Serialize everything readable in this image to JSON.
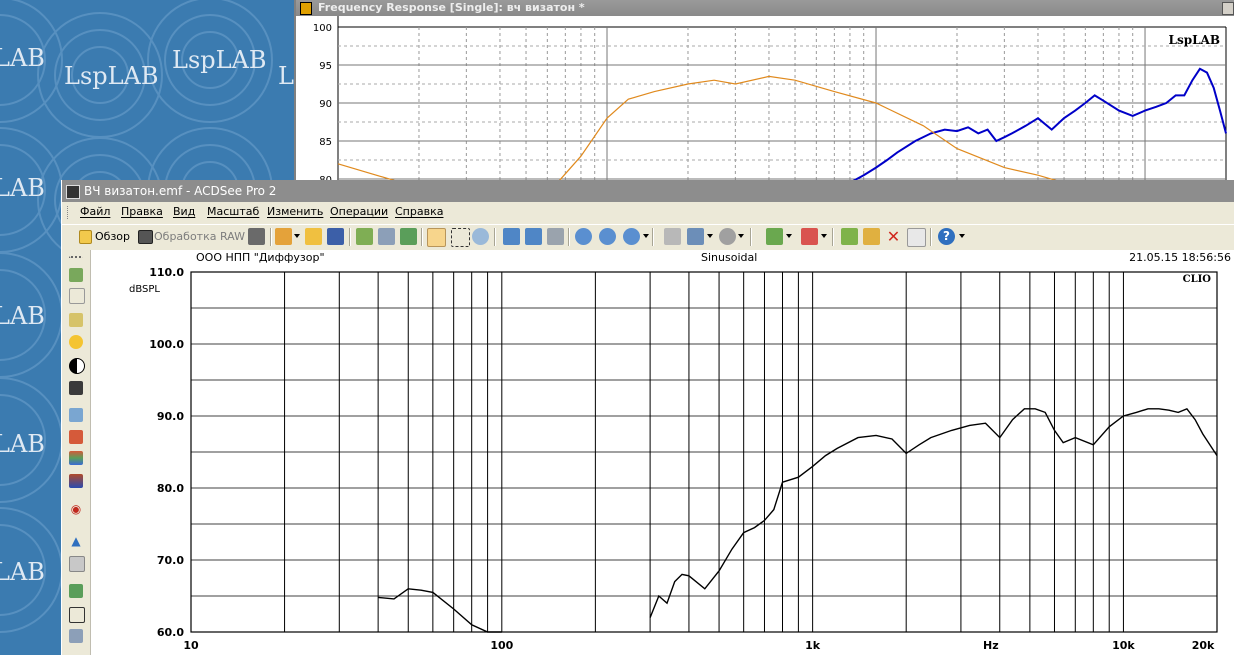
{
  "background_window": {
    "title": "Frequency Response [Single]: вч визатон *",
    "chart_data": {
      "type": "line",
      "watermark": "LspLAB",
      "y_tick_labels": [
        "100",
        "95",
        "90",
        "85",
        "80"
      ],
      "ylim_visible": [
        80,
        100
      ],
      "series": [
        {
          "color": "#0000c8",
          "x": [
            800,
            900,
            1000,
            1100,
            1200,
            1400,
            1600,
            1800,
            2000,
            2200,
            2400,
            2600,
            2800,
            3000,
            3200,
            3600,
            4000,
            4500,
            5000,
            5500,
            6000,
            6500,
            7000,
            8000,
            9000,
            10000,
            11000,
            12000,
            13000,
            14000,
            15000,
            16000,
            17000,
            18000,
            19000,
            20000
          ],
          "y": [
            79.5,
            80.5,
            81.5,
            82.5,
            83.5,
            85,
            86,
            86.5,
            86.3,
            86.8,
            86,
            86.5,
            85,
            85.5,
            86,
            87,
            88,
            86.5,
            88,
            89,
            90,
            91,
            90.3,
            89,
            88.3,
            89,
            89.5,
            90,
            91,
            91,
            93,
            94.5,
            94,
            92,
            89,
            86
          ]
        },
        {
          "color": "#e08a1e",
          "x": [
            10,
            30,
            40,
            60,
            80,
            100,
            120,
            150,
            200,
            250,
            300,
            400,
            500,
            700,
            1000,
            1500,
            2000,
            3000,
            4000,
            5000
          ],
          "y": [
            82,
            77,
            76,
            78,
            83,
            88,
            90.5,
            91.5,
            92.5,
            93,
            92.5,
            93.5,
            93,
            91.5,
            90,
            87,
            84,
            81.5,
            80.5,
            79.5
          ]
        }
      ]
    }
  },
  "front_window": {
    "title": "ВЧ визатон.emf - ACDSee Pro 2",
    "menu": [
      "Файл",
      "Правка",
      "Вид",
      "Масштаб",
      "Изменить",
      "Операции",
      "Справка"
    ],
    "toolbar": {
      "browse_label": "Обзор",
      "raw_label": "Обработка RAW"
    },
    "chart_data": {
      "type": "line",
      "header_left": "ООО НПП \"Диффузор\"",
      "header_center": "Sinusoidal",
      "header_right": "21.05.15 18:56:56",
      "watermark": "CLIO",
      "ylabel": "dBSPL",
      "xlabel": "Hz",
      "y_tick_labels": [
        "110.0",
        "100.0",
        "90.0",
        "80.0",
        "70.0",
        "60.0"
      ],
      "x_tick_labels": [
        "10",
        "100",
        "1k",
        "10k",
        "20k"
      ],
      "x_scale": "log",
      "xlim": [
        10,
        20000
      ],
      "ylim": [
        60,
        110
      ],
      "grid": true,
      "series": [
        {
          "color": "#000000",
          "x": [
            40,
            45,
            50,
            55,
            60,
            70,
            80,
            90,
            100,
            300,
            320,
            340,
            360,
            380,
            400,
            450,
            500,
            550,
            600,
            650,
            700,
            750,
            800,
            900,
            1000,
            1100,
            1200,
            1400,
            1600,
            1800,
            2000,
            2200,
            2400,
            2800,
            3200,
            3600,
            4000,
            4400,
            4800,
            5200,
            5600,
            6000,
            6400,
            7000,
            8000,
            9000,
            10000,
            11000,
            12000,
            13000,
            14000,
            15000,
            16000,
            17000,
            18000,
            20000
          ],
          "y": [
            64.8,
            64.6,
            66,
            65.8,
            65.5,
            63.2,
            61,
            59.8,
            59.7,
            62,
            65,
            64,
            67,
            68,
            67.8,
            66,
            68.5,
            71.5,
            73.8,
            74.5,
            75.5,
            77,
            80.8,
            81.5,
            83,
            84.5,
            85.5,
            87,
            87.3,
            86.8,
            84.8,
            86,
            87,
            88,
            88.7,
            89,
            87,
            89.5,
            91,
            91,
            90.5,
            88,
            86.3,
            87,
            86,
            88.5,
            90,
            90.5,
            91,
            91,
            90.8,
            90.5,
            91,
            89.5,
            87.5,
            84.5
          ]
        }
      ]
    }
  }
}
